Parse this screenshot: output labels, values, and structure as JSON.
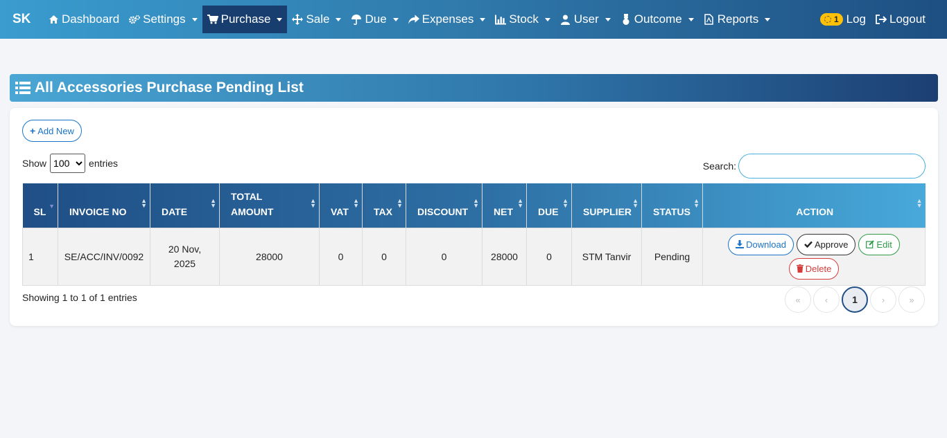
{
  "nav": {
    "brand": "SK",
    "items": [
      {
        "label": "Dashboard",
        "icon": "home-icon",
        "dropdown": false
      },
      {
        "label": "Settings",
        "icon": "gears-icon",
        "dropdown": true
      },
      {
        "label": "Purchase",
        "icon": "cart-icon",
        "dropdown": true,
        "active": true
      },
      {
        "label": "Sale",
        "icon": "move-icon",
        "dropdown": true
      },
      {
        "label": "Due",
        "icon": "umbrella-icon",
        "dropdown": true
      },
      {
        "label": "Expenses",
        "icon": "share-icon",
        "dropdown": true
      },
      {
        "label": "Stock",
        "icon": "bar-chart-icon",
        "dropdown": true
      },
      {
        "label": "User",
        "icon": "user-icon",
        "dropdown": true
      },
      {
        "label": "Outcome",
        "icon": "snowman-icon",
        "dropdown": true
      },
      {
        "label": "Reports",
        "icon": "pdf-file-icon",
        "dropdown": true
      }
    ],
    "log_badge": "1",
    "log_label": "Log",
    "logout_label": "Logout"
  },
  "page": {
    "title": "All Accessories Purchase Pending List"
  },
  "toolbar": {
    "add_new": "Add New",
    "show_label": "Show",
    "entries_value": "100",
    "entries_label": "entries",
    "search_label": "Search:",
    "search_value": ""
  },
  "table": {
    "headers": [
      "SL",
      "INVOICE NO",
      "DATE",
      "TOTAL AMOUNT",
      "VAT",
      "TAX",
      "DISCOUNT",
      "NET",
      "DUE",
      "SUPPLIER",
      "STATUS",
      "ACTION"
    ],
    "rows": [
      {
        "sl": "1",
        "invoice": "SE/ACC/INV/0092",
        "date": "20 Nov, 2025",
        "total": "28000",
        "vat": "0",
        "tax": "0",
        "discount": "0",
        "net": "28000",
        "due": "0",
        "supplier": "STM Tanvir",
        "status": "Pending"
      }
    ],
    "actions": {
      "download": "Download",
      "approve": "Approve",
      "edit": "Edit",
      "delete": "Delete"
    }
  },
  "footer": {
    "info": "Showing 1 to 1 of 1 entries",
    "pages": [
      "«",
      "‹",
      "1",
      "›",
      "»"
    ],
    "current_page": "1"
  }
}
